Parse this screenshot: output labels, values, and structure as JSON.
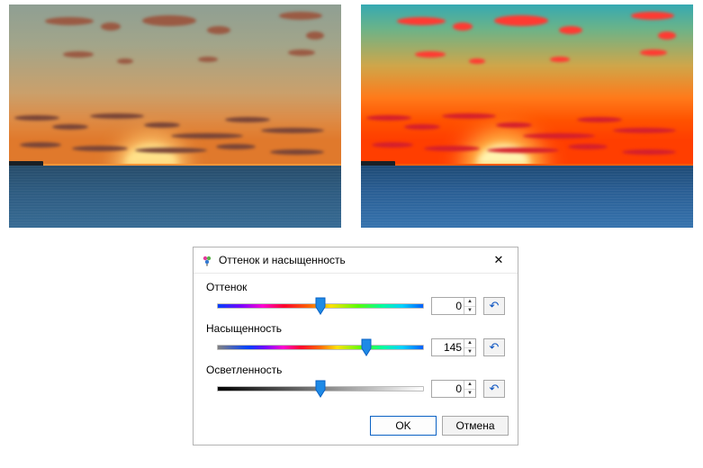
{
  "dialog": {
    "title": "Оттенок и насыщенность",
    "close_glyph": "✕",
    "reset_glyph": "↶",
    "spin_up_glyph": "▲",
    "spin_down_glyph": "▼",
    "ok_label": "OK",
    "cancel_label": "Отмена",
    "sliders": {
      "hue": {
        "label": "Оттенок",
        "value": 0,
        "min": -180,
        "max": 180,
        "thumb_pct": 50
      },
      "saturation": {
        "label": "Насыщенность",
        "value": 145,
        "min": 0,
        "max": 200,
        "thumb_pct": 72
      },
      "lightness": {
        "label": "Осветленность",
        "value": 0,
        "min": -100,
        "max": 100,
        "thumb_pct": 50
      }
    }
  },
  "images": {
    "left": {
      "name": "preview-original",
      "saturated": false
    },
    "right": {
      "name": "preview-saturated",
      "saturated": true
    }
  },
  "colors": {
    "accent": "#0a62c4"
  }
}
